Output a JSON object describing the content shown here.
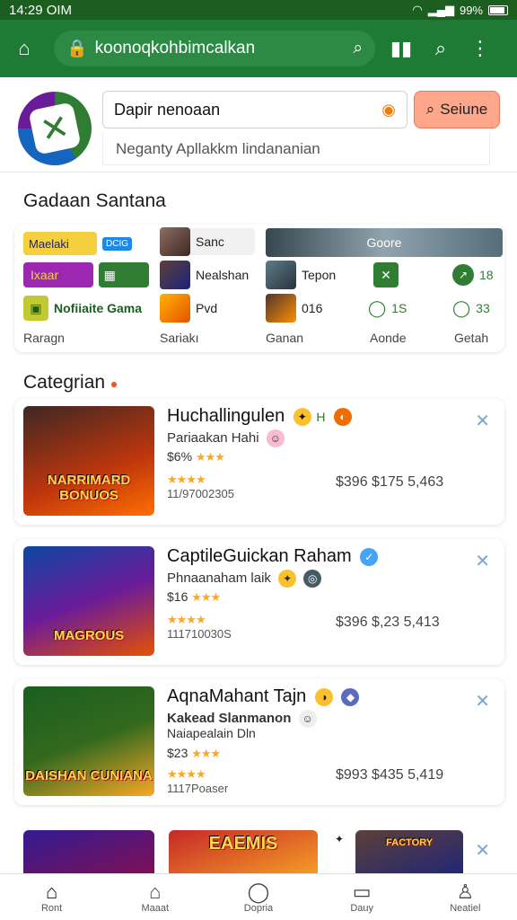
{
  "status": {
    "time": "14:29 OIM",
    "battery": "99%"
  },
  "browser": {
    "url": "koonoqkohbimcalkan"
  },
  "search": {
    "placeholder": "Dapir nenoaan",
    "button_label": "Seiune",
    "suggestion": "Neganty Apllakkm lindananian"
  },
  "featured": {
    "title": "Gadaan Santana",
    "chips": [
      {
        "label": "Maelaki",
        "color": "#f4d03f"
      },
      {
        "label": "DCIG",
        "color": "#1e88e5"
      },
      {
        "label": "Sanc",
        "color": "#8d6e63"
      },
      {
        "label": "Goore",
        "color": "#90a4ae"
      },
      {
        "label": "Ixaar",
        "color": "#9c27b0"
      },
      {
        "label": "Nealshan",
        "color": "#5d4037"
      },
      {
        "label": "Tepon",
        "color": "#607d8b"
      },
      {
        "label": "18",
        "color": "#2e7d32"
      },
      {
        "label": "Nofiiaite Gama",
        "color": "#c0ca33"
      },
      {
        "label": "Pvd",
        "color": "#ffb300"
      },
      {
        "label": "016",
        "color": "#4e342e"
      },
      {
        "label": "1S",
        "color": "#2e7d32"
      },
      {
        "label": "33",
        "color": "#2e7d32"
      }
    ],
    "footers": [
      "Raragn",
      "Sariakı",
      "Ganan",
      "Aonde",
      "Getah"
    ]
  },
  "categories": {
    "title": "Categrian",
    "apps": [
      {
        "title": "Huchallingulen",
        "subtitle": "Pariaakan Hahi",
        "price_small": "$6%",
        "count": "11/97002305",
        "prices": "$396 $175 5,463",
        "art_text": "NARRIMARD BONUOS",
        "art_colors": [
          "#3e2723",
          "#bf360c"
        ]
      },
      {
        "title": "CaptileGuickan Raham",
        "subtitle": "Phnaanaham laik",
        "price_small": "$16",
        "count": "111710030S",
        "prices": "$396 $,23 5,413",
        "art_text": "MAGROUS",
        "art_colors": [
          "#0d47a1",
          "#e65100"
        ]
      },
      {
        "title": "AqnaMahant Tajn",
        "subtitle": "Kakead Slanmanon",
        "subtitle2": "Naiapealain Dln",
        "price_small": "$23",
        "count": "1117Poaser",
        "prices": "$993 $435 5,419",
        "art_text": "DAISHAN CUNIANA",
        "art_colors": [
          "#1b5e20",
          "#f9a825"
        ]
      }
    ],
    "last_row": {
      "art_text_2": "EAEMIS",
      "art_text_3": "FACTORY"
    }
  },
  "bottom_nav": [
    {
      "label": "Ront",
      "icon": "home-icon"
    },
    {
      "label": "Maaat",
      "icon": "store-icon"
    },
    {
      "label": "Dopria",
      "icon": "discover-icon"
    },
    {
      "label": "Dauy",
      "icon": "tablet-icon"
    },
    {
      "label": "Neatiel",
      "icon": "person-icon"
    }
  ]
}
